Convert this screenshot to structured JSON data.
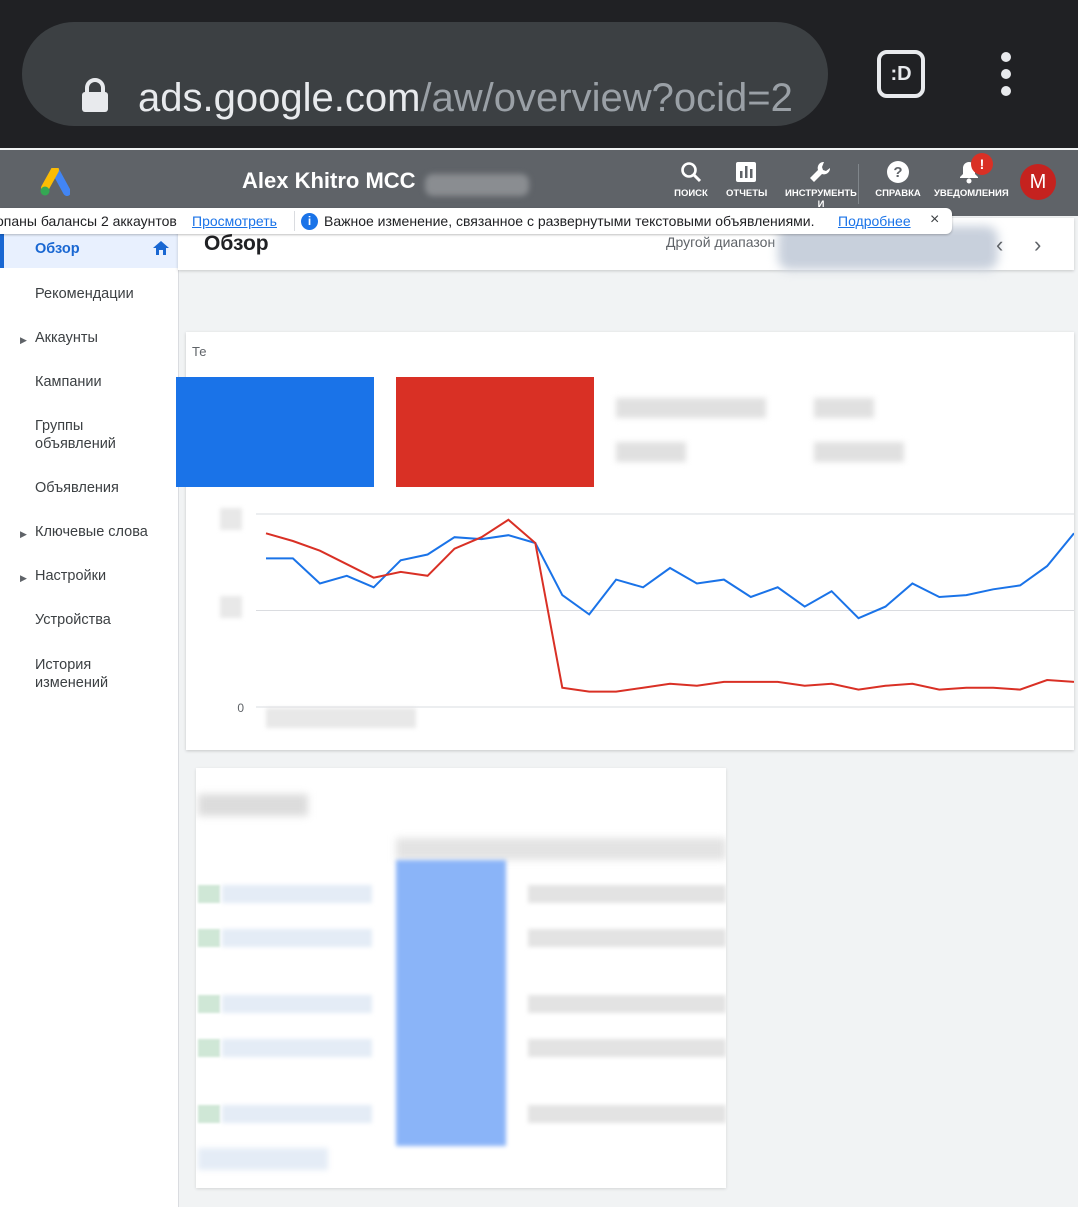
{
  "browser": {
    "url_host": "ads.google.com",
    "url_path": "/aw/overview?ocid=2",
    "extension_label": ":D"
  },
  "header": {
    "account_name": "Alex Khitro MCC",
    "actions": [
      {
        "icon": "search-icon",
        "label": "ПОИСК"
      },
      {
        "icon": "reports-icon",
        "label": "ОТЧЕТЫ"
      },
      {
        "icon": "wrench-icon",
        "label": "ИНСТРУМЕНТЫ И"
      },
      {
        "icon": "help-icon",
        "label": "СПРАВКА"
      },
      {
        "icon": "bell-icon",
        "label": "УВЕДОМЛЕНИЯ"
      }
    ],
    "notification_badge": "!",
    "avatar_letter": "M"
  },
  "notice": {
    "text_1": "опаны балансы 2 аккаунтов",
    "link_1": "Просмотреть",
    "info_glyph": "i",
    "text_2": "Важное изменение, связанное с развернутыми текстовыми объявлениями.",
    "link_2": "Подробнее",
    "close": "×"
  },
  "sidebar": {
    "items": [
      {
        "label": "Обзор",
        "active": true
      },
      {
        "label": "Рекомендации"
      },
      {
        "label": "Аккаунты",
        "expandable": true
      },
      {
        "label": "Кампании"
      },
      {
        "label": "Группы объявлений"
      },
      {
        "label": "Объявления"
      },
      {
        "label": "Ключевые слова",
        "expandable": true
      },
      {
        "label": "Настройки",
        "expandable": true
      },
      {
        "label": "Устройства"
      },
      {
        "label": "История изменений"
      }
    ]
  },
  "main": {
    "title": "Обзор",
    "date_range_label": "Другой диапазон",
    "chart_card_title": "Те",
    "metric_colors": {
      "blue": "#1a73e8",
      "red": "#d93025"
    }
  },
  "chart_data": {
    "type": "line",
    "y_tick_zero": "0",
    "ylim": [
      0,
      100
    ],
    "grid": true,
    "series": [
      {
        "color": "#1a73e8",
        "values": [
          77,
          77,
          64,
          68,
          62,
          76,
          79,
          88,
          87,
          89,
          85,
          58,
          48,
          66,
          62,
          72,
          64,
          66,
          57,
          62,
          52,
          60,
          46,
          52,
          64,
          57,
          58,
          61,
          63,
          73,
          90
        ]
      },
      {
        "color": "#d93025",
        "values": [
          90,
          86,
          81,
          74,
          67,
          70,
          68,
          82,
          88,
          97,
          85,
          10,
          8,
          8,
          10,
          12,
          11,
          13,
          13,
          13,
          11,
          12,
          9,
          11,
          12,
          9,
          10,
          10,
          9,
          14,
          13
        ]
      }
    ]
  }
}
